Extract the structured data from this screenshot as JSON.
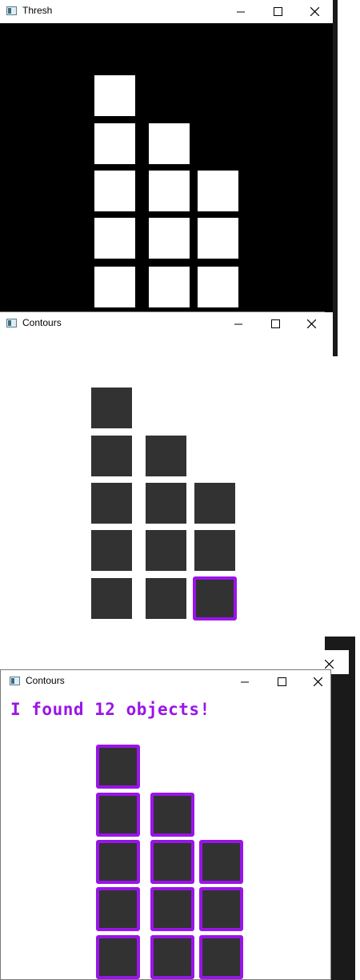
{
  "windows": {
    "thresh": {
      "title": "Thresh"
    },
    "contours_mid": {
      "title": "Contours"
    },
    "contours_bottom": {
      "title": "Contours",
      "message": "I found 12 objects!"
    }
  },
  "colors": {
    "contour_outline": "#9a14e8",
    "object_fill": "#323232",
    "thresh_bg": "#000000",
    "thresh_fg": "#ffffff"
  },
  "icons": [
    "window-app-icon",
    "minimize-icon",
    "maximize-icon",
    "close-icon"
  ],
  "object_count": 12,
  "highlighted_in_middle_window": 1
}
